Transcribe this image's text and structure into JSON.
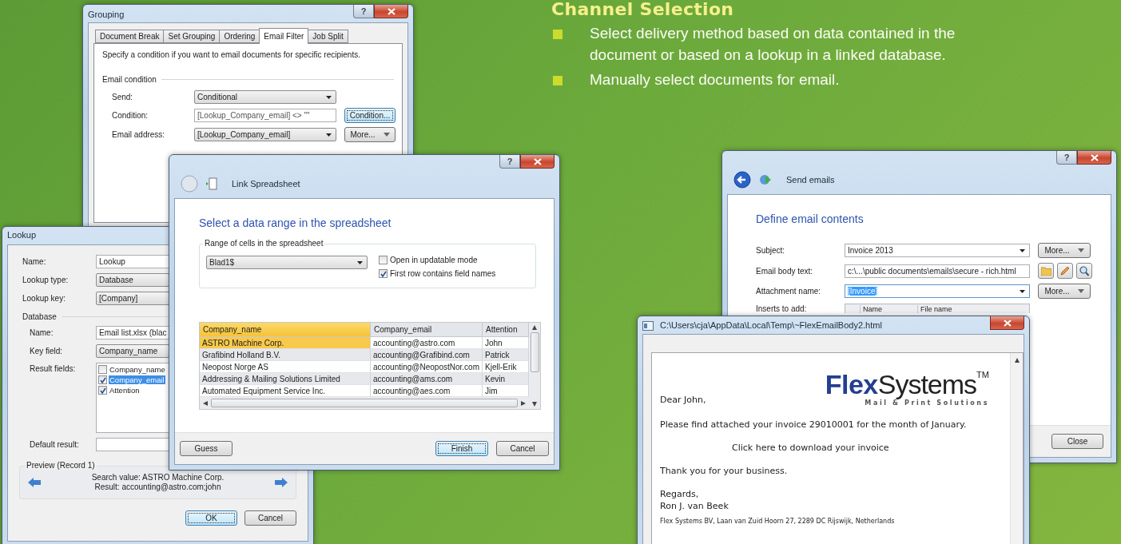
{
  "heading": "Channel Selection",
  "bullets": [
    "Select delivery method based on data contained in the document or based on a lookup in a linked database.",
    "Manually select documents for email."
  ],
  "grouping_dialog": {
    "title": "Grouping",
    "help": "?",
    "tabs": [
      {
        "label": "Document Break",
        "selected": false
      },
      {
        "label": "Set Grouping",
        "selected": false
      },
      {
        "label": "Ordering",
        "selected": false
      },
      {
        "label": "Email Filter",
        "selected": true
      },
      {
        "label": "Job Split",
        "selected": false
      }
    ],
    "description": "Specify a condition if you want to email documents for specific recipients.",
    "group_label": "Email condition",
    "rows": [
      {
        "label": "Send:",
        "kind": "combo",
        "value": "Conditional"
      },
      {
        "label": "Condition:",
        "kind": "readonly",
        "value": "[Lookup_Company_email] <> \"\"",
        "button": {
          "label": "Condition...",
          "kind": "plain",
          "focused": true
        }
      },
      {
        "label": "Email address:",
        "kind": "combo",
        "value": "[Lookup_Company_email]",
        "button": {
          "label": "More...",
          "kind": "menu",
          "focused": false
        }
      }
    ]
  },
  "lookup_dialog": {
    "title": "Lookup",
    "fields": [
      {
        "label": "Name:",
        "kind": "text",
        "value": "Lookup"
      },
      {
        "label": "Lookup type:",
        "kind": "combo",
        "value": "Database"
      },
      {
        "label": "Lookup key:",
        "kind": "combo",
        "value": "[Company]"
      }
    ],
    "database_label": "Database",
    "database_fields": [
      {
        "label": "Name:",
        "kind": "text",
        "value": "Email list.xlsx (blac"
      },
      {
        "label": "Key field:",
        "kind": "combo",
        "value": "Company_name"
      }
    ],
    "result_fields_label": "Result fields:",
    "result_fields": [
      {
        "label": "Company_name",
        "checked": false,
        "selected": false
      },
      {
        "label": "Company_email",
        "checked": true,
        "selected": true
      },
      {
        "label": "Attention",
        "checked": true,
        "selected": false
      }
    ],
    "default_result_label": "Default result:",
    "preview": {
      "label": "Preview (Record 1)",
      "search_value": "Search value: ASTRO Machine Corp.",
      "result": "Result: accounting@astro.com;john"
    },
    "buttons": [
      {
        "label": "OK",
        "default": true
      },
      {
        "label": "Cancel",
        "default": false
      }
    ]
  },
  "link_dialog": {
    "title": "Link Spreadsheet",
    "help": "?",
    "heading": "Select a data range in the spreadsheet",
    "group_label": "Range of cells in the spreadsheet",
    "range": "Blad1$",
    "options": [
      {
        "label": "Open in updatable mode",
        "checked": false
      },
      {
        "label": "First row contains field names",
        "checked": true
      }
    ],
    "columns": [
      {
        "label": "Company_name",
        "selected": true
      },
      {
        "label": "Company_email",
        "selected": false
      },
      {
        "label": "Attention",
        "selected": false
      }
    ],
    "rows": [
      {
        "cells": [
          "ASTRO Machine Corp.",
          "accounting@astro.com",
          "John"
        ],
        "selected": true
      },
      {
        "cells": [
          "Grafibind Holland B.V.",
          "accounting@Grafibind.com",
          "Patrick"
        ],
        "selected": false
      },
      {
        "cells": [
          "Neopost Norge AS",
          "accounting@NeopostNor.com",
          "Kjell-Erik"
        ],
        "selected": false
      },
      {
        "cells": [
          "Addressing & Mailing Solutions Limited",
          "accounting@ams.com",
          "Kevin"
        ],
        "selected": false
      },
      {
        "cells": [
          "Automated Equipment Service Inc.",
          "accounting@aes.com",
          "Jim"
        ],
        "selected": false
      }
    ],
    "buttons": [
      {
        "label": "Guess",
        "default": false
      },
      {
        "label": "Finish",
        "default": true
      },
      {
        "label": "Cancel",
        "default": false
      }
    ]
  },
  "send_dialog": {
    "title": "Send emails",
    "help": "?",
    "heading": "Define email contents",
    "rows": [
      {
        "label": "Subject:",
        "kind": "combo",
        "value": "Invoice 2013",
        "value_selected": false,
        "action": "More..."
      },
      {
        "label": "Email body text:",
        "kind": "file",
        "value": "c:\\...\\public documents\\emails\\secure - rich.html",
        "value_selected": false
      },
      {
        "label": "Attachment name:",
        "kind": "combo",
        "value": "[Invoice]",
        "value_selected": true,
        "action": "More..."
      }
    ],
    "inserts_label": "Inserts to add:",
    "inserts_columns": [
      "Name",
      "File name"
    ],
    "buttons": [
      {
        "label": "Close",
        "default": false
      }
    ]
  },
  "email_window": {
    "title": "C:\\Users\\cja\\AppData\\Local\\Temp\\~FlexEmailBody2.html",
    "logo": "**Flex**Systems$^{TM}$",
    "tagline": "Mail & Print Solutions",
    "greeting": "Dear John,",
    "body": [
      {
        "kind": "text",
        "text": "Please find attached your invoice 29010001 for the month of January."
      },
      {
        "kind": "link",
        "text": "Click here to download your invoice"
      },
      {
        "kind": "text",
        "text": "Thank you for your business."
      },
      {
        "kind": "text",
        "text": "Regards,"
      },
      {
        "kind": "signature",
        "text": "Ron J. van Beek"
      },
      {
        "kind": "footer",
        "text": "Flex Systems BV, Laan van Zuid Hoorn 27, 2289 DC Rijswijk, Netherlands"
      }
    ]
  }
}
